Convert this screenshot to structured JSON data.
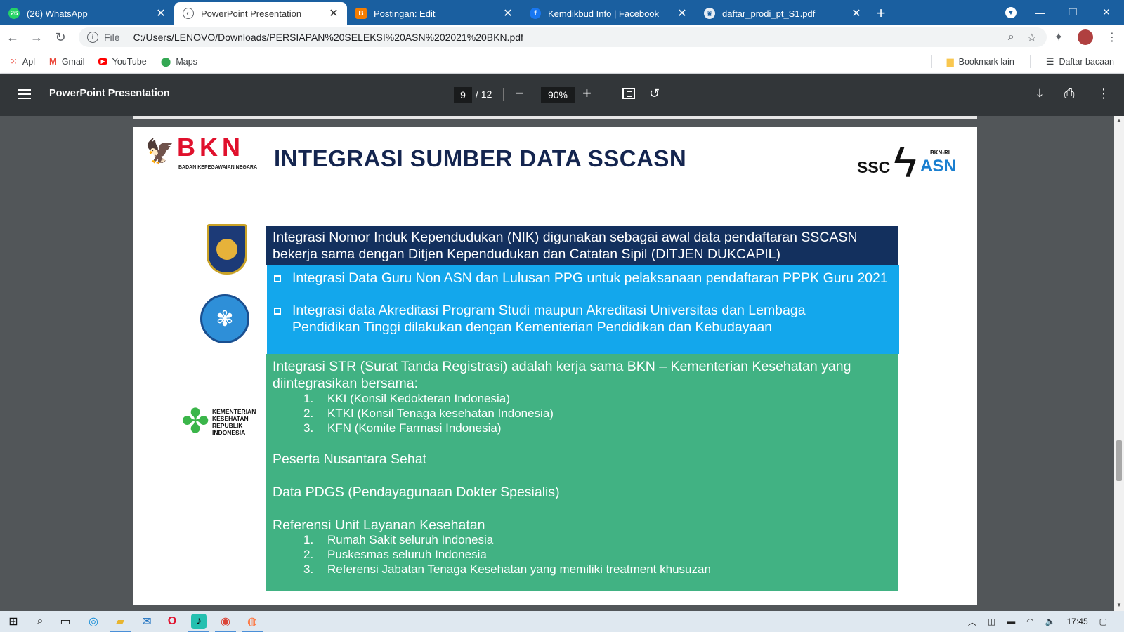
{
  "tabs": [
    {
      "label": "(26) WhatsApp",
      "icon": "whatsapp-icon",
      "color": "#25d366",
      "active": false
    },
    {
      "label": "PowerPoint Presentation",
      "icon": "globe-icon",
      "color": "#5f6368",
      "active": true
    },
    {
      "label": "Postingan: Edit",
      "icon": "blogger-icon",
      "color": "#f57d00",
      "active": false
    },
    {
      "label": "Kemdikbud Info | Facebook",
      "icon": "facebook-icon",
      "color": "#1877f2",
      "active": false
    },
    {
      "label": "daftar_prodi_pt_S1.pdf",
      "icon": "pdf-globe-icon",
      "color": "#5f6368",
      "active": false
    }
  ],
  "omnibox": {
    "scheme": "File",
    "url": "C:/Users/LENOVO/Downloads/PERSIAPAN%20SELEKSI%20ASN%202021%20BKN.pdf"
  },
  "bookmarks": {
    "items": [
      "Apl",
      "Gmail",
      "YouTube",
      "Maps"
    ],
    "other": "Bookmark lain",
    "reading_list": "Daftar bacaan"
  },
  "pdf": {
    "title": "PowerPoint Presentation",
    "page": "9",
    "total": "/ 12",
    "zoom": "90%"
  },
  "slide": {
    "bkn_logo": "BKN",
    "bkn_sub": "BADAN KEPEGAWAIAN NEGARA",
    "title": "INTEGRASI SUMBER DATA SSCASN",
    "ssc_logo_left": "SSC",
    "ssc_logo_right": "ASN",
    "ssc_logo_small": "BKN-RI",
    "kemenkes_text": [
      "KEMENTERIAN",
      "KESEHATAN",
      "REPUBLIK",
      "INDONESIA"
    ],
    "box1_lines": [
      "Integrasi Nomor Induk Kependudukan (NIK) digunakan sebagai awal data pendaftaran SSCASN",
      "bekerja sama dengan Ditjen Kependudukan dan Catatan Sipil (DITJEN DUKCAPIL)"
    ],
    "box2_items": [
      {
        "lines": [
          "Integrasi Data Guru Non ASN dan Lulusan PPG untuk pelaksanaan pendaftaran PPPK Guru 2021"
        ]
      },
      {
        "lines": [
          "Integrasi data Akreditasi Program Studi maupun Akreditasi Universitas dan Lembaga",
          "Pendidikan Tinggi dilakukan dengan Kementerian Pendidikan dan Kebudayaan"
        ]
      }
    ],
    "box3": {
      "str_lines": [
        "Integrasi STR (Surat Tanda Registrasi) adalah kerja sama BKN – Kementerian Kesehatan yang",
        "diintegrasikan bersama:"
      ],
      "str_list": [
        "KKI (Konsil Kedokteran Indonesia)",
        "KTKI (Konsil Tenaga kesehatan Indonesia)",
        "KFN (Komite Farmasi Indonesia)"
      ],
      "nusantara": "Peserta Nusantara Sehat",
      "pdgs": "Data PDGS (Pendayagunaan Dokter Spesialis)",
      "ref_title": "Referensi Unit Layanan Kesehatan",
      "ref_list": [
        "Rumah Sakit seluruh Indonesia",
        "Puskesmas seluruh Indonesia",
        "Referensi Jabatan Tenaga Kesehatan yang memiliki treatment khusuzan"
      ]
    },
    "colors": {
      "navy": "#13305e",
      "sky": "#13a7ec",
      "green": "#41b283",
      "title": "#14254f",
      "bkn_red": "#e0102c"
    }
  },
  "taskbar": {
    "clock": "17:45"
  },
  "list_numbers": [
    "1.",
    "2.",
    "3."
  ]
}
